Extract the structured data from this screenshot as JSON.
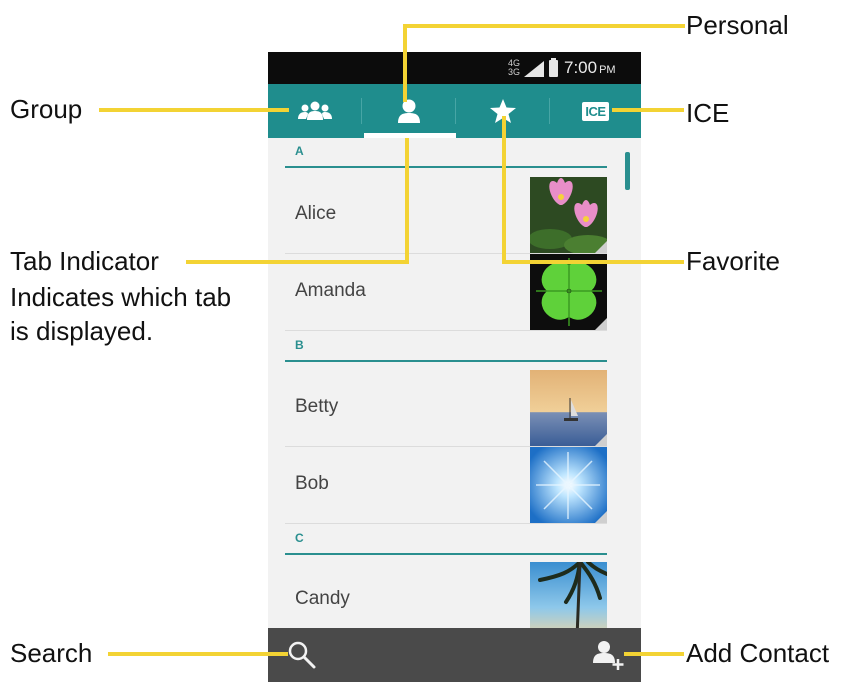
{
  "status_bar": {
    "network_top": "4G",
    "network_bottom": "3G",
    "time": "7:00",
    "ampm": "PM"
  },
  "tabs": [
    {
      "name": "Group",
      "icon": "group-icon"
    },
    {
      "name": "Personal",
      "icon": "person-icon",
      "selected": true
    },
    {
      "name": "Favorite",
      "icon": "star-icon"
    },
    {
      "name": "ICE",
      "icon": "ice-icon",
      "badge": "ICE"
    }
  ],
  "contacts": {
    "sections": [
      {
        "letter": "A",
        "items": [
          {
            "name": "Alice",
            "photo": "pink-lotus-flowers"
          },
          {
            "name": "Amanda",
            "photo": "green-four-leaf-clover"
          }
        ]
      },
      {
        "letter": "B",
        "items": [
          {
            "name": "Betty",
            "photo": "sailboat-sunset"
          },
          {
            "name": "Bob",
            "photo": "blue-sky-sun"
          }
        ]
      },
      {
        "letter": "C",
        "items": [
          {
            "name": "Candy",
            "photo": "palm-tree-beach"
          }
        ]
      }
    ]
  },
  "callouts": {
    "personal": "Personal",
    "group": "Group",
    "ice": "ICE",
    "tab_indicator_title": "Tab Indicator",
    "tab_indicator_desc_1": "Indicates which tab",
    "tab_indicator_desc_2": "is displayed.",
    "favorite": "Favorite",
    "search": "Search",
    "add_contact": "Add Contact"
  },
  "colors": {
    "accent_teal": "#1f8d8d",
    "callout_yellow": "#f3d334",
    "bottom_bar": "#4a4a4a",
    "status_bar": "#0c0c0c"
  }
}
